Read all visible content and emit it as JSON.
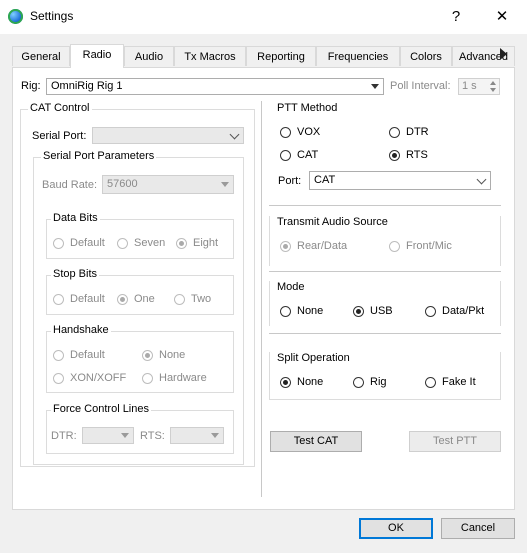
{
  "window": {
    "title": "Settings",
    "help": "?",
    "close": "✕"
  },
  "tabs": [
    {
      "label": "General"
    },
    {
      "label": "Radio"
    },
    {
      "label": "Audio"
    },
    {
      "label": "Tx Macros"
    },
    {
      "label": "Reporting"
    },
    {
      "label": "Frequencies"
    },
    {
      "label": "Colors"
    },
    {
      "label": "Advanced"
    }
  ],
  "rig": {
    "label": "Rig:",
    "value": "OmniRig Rig 1",
    "poll_label": "Poll Interval:",
    "poll_value": "1 s"
  },
  "cat": {
    "title": "CAT Control",
    "serial_port_label": "Serial Port:",
    "serial_params_title": "Serial Port Parameters",
    "baud_label": "Baud Rate:",
    "baud_value": "57600",
    "data_bits": {
      "title": "Data Bits",
      "opts": [
        "Default",
        "Seven",
        "Eight"
      ]
    },
    "stop_bits": {
      "title": "Stop Bits",
      "opts": [
        "Default",
        "One",
        "Two"
      ]
    },
    "handshake": {
      "title": "Handshake",
      "opts": [
        "Default",
        "None",
        "XON/XOFF",
        "Hardware"
      ]
    },
    "force": {
      "title": "Force Control Lines",
      "dtr": "DTR:",
      "rts": "RTS:"
    }
  },
  "ptt": {
    "title": "PTT Method",
    "opts": [
      "VOX",
      "DTR",
      "CAT",
      "RTS"
    ],
    "port_label": "Port:",
    "port_value": "CAT"
  },
  "tx_audio": {
    "title": "Transmit Audio Source",
    "opts": [
      "Rear/Data",
      "Front/Mic"
    ]
  },
  "mode": {
    "title": "Mode",
    "opts": [
      "None",
      "USB",
      "Data/Pkt"
    ]
  },
  "split": {
    "title": "Split Operation",
    "opts": [
      "None",
      "Rig",
      "Fake It"
    ]
  },
  "buttons": {
    "test_cat": "Test CAT",
    "test_ptt": "Test PTT",
    "ok": "OK",
    "cancel": "Cancel"
  }
}
